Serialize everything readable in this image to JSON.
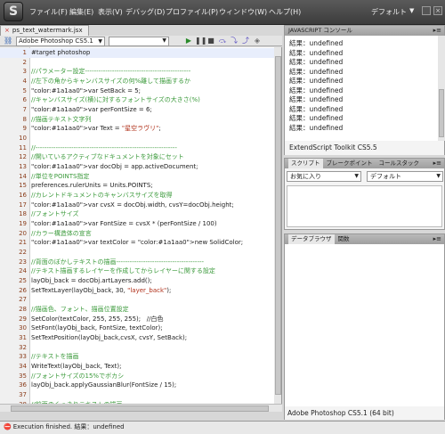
{
  "menubar": {
    "items": [
      "ファイル(F)",
      "編集(E)",
      "表示(V)",
      "デバッグ(D)",
      "プロファイル(P)",
      "ウィンドウ(W)",
      "ヘルプ(H)"
    ],
    "workspace": "デフォルト"
  },
  "editor": {
    "tab_label": "ps_text_watermark.jsx",
    "target_app": "Adobe Photoshop CS5.1",
    "function_select": "",
    "lines": [
      {
        "n": "1",
        "text": "#target photoshop",
        "type": "code"
      },
      {
        "n": "2",
        "text": "",
        "type": "code"
      },
      {
        "n": "3",
        "text": "//パラメーター設定-----------------------------------------------",
        "type": "comment"
      },
      {
        "n": "4",
        "text": "//左下の角からキャンバスサイズの何%離して描画するか",
        "type": "comment"
      },
      {
        "n": "5",
        "text": "var SetBack = 5;",
        "type": "code"
      },
      {
        "n": "6",
        "text": "//キャンバスサイズ(横)に対するフォントサイズの大きさ(%)",
        "type": "comment"
      },
      {
        "n": "7",
        "text": "var perFontSize = 6;",
        "type": "code"
      },
      {
        "n": "8",
        "text": "//描画テキスト文字列",
        "type": "comment"
      },
      {
        "n": "9",
        "text": "var Text = \"星空ラヴリ\";",
        "type": "code"
      },
      {
        "n": "10",
        "text": "",
        "type": "code"
      },
      {
        "n": "11",
        "text": "//---------------------------------------------------------------",
        "type": "comment"
      },
      {
        "n": "12",
        "text": "//開いているアクティブなドキュメントを対象にセット",
        "type": "comment"
      },
      {
        "n": "13",
        "text": "var docObj = app.activeDocument;",
        "type": "code"
      },
      {
        "n": "14",
        "text": "//単位をPOINTS指定",
        "type": "comment"
      },
      {
        "n": "15",
        "text": "preferences.rulerUnits = Units.POINTS;",
        "type": "code"
      },
      {
        "n": "16",
        "text": "//カレントドキュメントのキャンバスサイズを取得",
        "type": "comment"
      },
      {
        "n": "17",
        "text": "var cvsX = docObj.width, cvsY=docObj.height;",
        "type": "code"
      },
      {
        "n": "18",
        "text": "//フォントサイズ",
        "type": "comment"
      },
      {
        "n": "19",
        "text": "var FontSize = cvsX * (perFontSize / 100)",
        "type": "code"
      },
      {
        "n": "20",
        "text": "//カラー構造体の宣言",
        "type": "comment"
      },
      {
        "n": "21",
        "text": "var textColor = new SolidColor;",
        "type": "code"
      },
      {
        "n": "22",
        "text": "",
        "type": "code"
      },
      {
        "n": "23",
        "text": "//背面のぼかしテキストの描画---------------------------------------",
        "type": "comment"
      },
      {
        "n": "24",
        "text": "//テキスト描画するレイヤーを作成してからレイヤーに関する設定",
        "type": "comment"
      },
      {
        "n": "25",
        "text": "layObj_back = docObj.artLayers.add();",
        "type": "code"
      },
      {
        "n": "26",
        "text": "SetTextLayer(layObj_back, 30, \"layer_back\");",
        "type": "code"
      },
      {
        "n": "27",
        "text": "",
        "type": "code"
      },
      {
        "n": "28",
        "text": "//描画色、フォント、描画位置設定",
        "type": "comment"
      },
      {
        "n": "29",
        "text": "SetColor(textColor, 255, 255, 255);   //白色",
        "type": "code"
      },
      {
        "n": "30",
        "text": "SetFont(layObj_back, FontSize, textColor);",
        "type": "code"
      },
      {
        "n": "31",
        "text": "SetTextPosition(layObj_back,cvsX, cvsY, SetBack);",
        "type": "code"
      },
      {
        "n": "32",
        "text": "",
        "type": "code"
      },
      {
        "n": "33",
        "text": "//テキストを描画",
        "type": "comment"
      },
      {
        "n": "34",
        "text": "WriteText(layObj_back, Text);",
        "type": "code"
      },
      {
        "n": "35",
        "text": "//フォントサイズの15%でボカシ",
        "type": "comment"
      },
      {
        "n": "36",
        "text": "layObj_back.applyGaussianBlur(FontSize / 15);",
        "type": "code"
      },
      {
        "n": "37",
        "text": "",
        "type": "code"
      },
      {
        "n": "38",
        "text": "//前面のくっきりテキストの描画-------------------------------------",
        "type": "comment"
      },
      {
        "n": "39",
        "text": "//テキスト描画するレイヤーを作成してからレイヤーに関する設定",
        "type": "comment"
      },
      {
        "n": "40",
        "text": "layObj_front = docObj.artLayers.add();",
        "type": "code"
      },
      {
        "n": "41",
        "text": "SetTextLayer(layObj_front, 60, \"layer_front\");",
        "type": "code"
      },
      {
        "n": "42",
        "text": "",
        "type": "code"
      }
    ]
  },
  "console": {
    "title": "JAVASCRIPT コンソール",
    "lines": [
      "結果：undefined",
      "結果：undefined",
      "結果：undefined",
      "結果：undefined",
      "結果：undefined",
      "結果：undefined",
      "結果：undefined",
      "結果：undefined",
      "結果：undefined",
      "結果：undefined"
    ],
    "footer": "ExtendScript Toolkit CS5.5"
  },
  "scripts": {
    "tabs": [
      "スクリプト",
      "ブレークポイント",
      "コールスタック"
    ],
    "dropdown_left": "お気に入り",
    "dropdown_right": "デフォルト"
  },
  "browser": {
    "tabs": [
      "データブラウザ",
      "関数"
    ],
    "footer": "Adobe Photoshop CS5.1 (64 bit)"
  },
  "status": {
    "text": "Execution finished. 結果：undefined"
  }
}
